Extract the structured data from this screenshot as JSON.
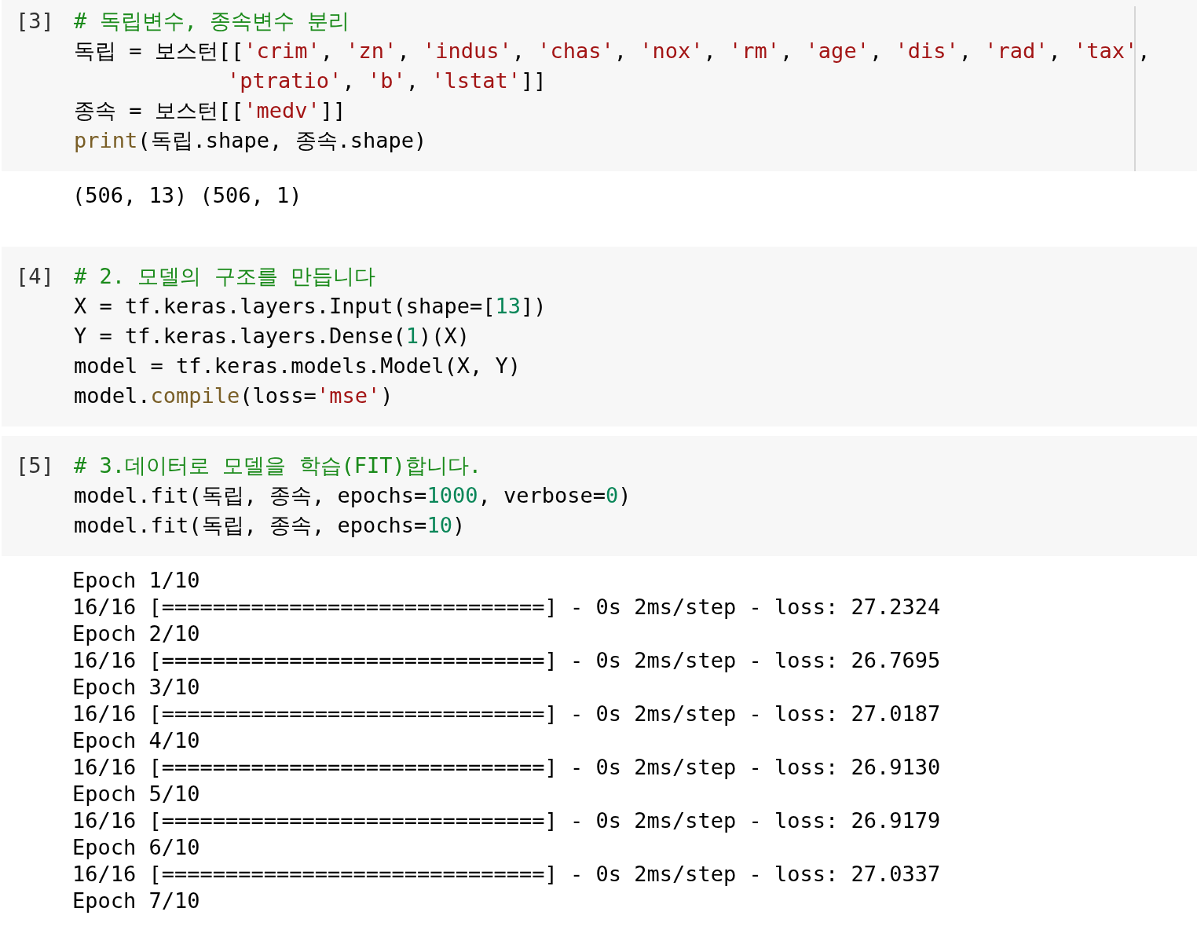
{
  "cells": [
    {
      "prompt": "[3]",
      "ruler": true,
      "code": [
        [
          {
            "kind": "comment",
            "text": "# 독립변수, 종속변수 분리"
          }
        ],
        [
          {
            "kind": "plain",
            "text": "독립 = 보스턴[["
          },
          {
            "kind": "string",
            "text": "'crim'"
          },
          {
            "kind": "plain",
            "text": ", "
          },
          {
            "kind": "string",
            "text": "'zn'"
          },
          {
            "kind": "plain",
            "text": ", "
          },
          {
            "kind": "string",
            "text": "'indus'"
          },
          {
            "kind": "plain",
            "text": ", "
          },
          {
            "kind": "string",
            "text": "'chas'"
          },
          {
            "kind": "plain",
            "text": ", "
          },
          {
            "kind": "string",
            "text": "'nox'"
          },
          {
            "kind": "plain",
            "text": ", "
          },
          {
            "kind": "string",
            "text": "'rm'"
          },
          {
            "kind": "plain",
            "text": ", "
          },
          {
            "kind": "string",
            "text": "'age'"
          },
          {
            "kind": "plain",
            "text": ", "
          },
          {
            "kind": "string",
            "text": "'dis'"
          },
          {
            "kind": "plain",
            "text": ", "
          },
          {
            "kind": "string",
            "text": "'rad'"
          },
          {
            "kind": "plain",
            "text": ", "
          },
          {
            "kind": "string",
            "text": "'tax'"
          },
          {
            "kind": "plain",
            "text": ","
          }
        ],
        [
          {
            "kind": "string",
            "text": "'ptratio'"
          },
          {
            "kind": "plain",
            "text": ", "
          },
          {
            "kind": "string",
            "text": "'b'"
          },
          {
            "kind": "plain",
            "text": ", "
          },
          {
            "kind": "string",
            "text": "'lstat'"
          },
          {
            "kind": "plain",
            "text": "]]"
          }
        ],
        [
          {
            "kind": "plain",
            "text": "종속 = 보스턴[["
          },
          {
            "kind": "string",
            "text": "'medv'"
          },
          {
            "kind": "plain",
            "text": "]]"
          }
        ],
        [
          {
            "kind": "builtin",
            "text": "print"
          },
          {
            "kind": "plain",
            "text": "(독립.shape, 종속.shape)"
          }
        ]
      ],
      "output": [
        "(506, 13) (506, 1)"
      ]
    },
    {
      "prompt": "[4]",
      "ruler": false,
      "code": [
        [
          {
            "kind": "comment",
            "text": "# 2. 모델의 구조를 만듭니다"
          }
        ],
        [
          {
            "kind": "plain",
            "text": "X = tf.keras.layers.Input(shape=["
          },
          {
            "kind": "number",
            "text": "13"
          },
          {
            "kind": "plain",
            "text": "])"
          }
        ],
        [
          {
            "kind": "plain",
            "text": "Y = tf.keras.layers.Dense("
          },
          {
            "kind": "number",
            "text": "1"
          },
          {
            "kind": "plain",
            "text": ")(X)"
          }
        ],
        [
          {
            "kind": "plain",
            "text": "model = tf.keras.models.Model(X, Y)"
          }
        ],
        [
          {
            "kind": "plain",
            "text": "model."
          },
          {
            "kind": "builtin",
            "text": "compile"
          },
          {
            "kind": "plain",
            "text": "(loss="
          },
          {
            "kind": "string",
            "text": "'mse'"
          },
          {
            "kind": "plain",
            "text": ")"
          }
        ]
      ]
    },
    {
      "prompt": "[5]",
      "ruler": false,
      "code": [
        [
          {
            "kind": "comment",
            "text": "# 3.데이터로 모델을 학습(FIT)합니다."
          }
        ],
        [
          {
            "kind": "plain",
            "text": "model.fit(독립, 종속, epochs="
          },
          {
            "kind": "number",
            "text": "1000"
          },
          {
            "kind": "plain",
            "text": ", verbose="
          },
          {
            "kind": "number",
            "text": "0"
          },
          {
            "kind": "plain",
            "text": ")"
          }
        ],
        [
          {
            "kind": "plain",
            "text": "model.fit(독립, 종속, epochs="
          },
          {
            "kind": "number",
            "text": "10"
          },
          {
            "kind": "plain",
            "text": ")"
          }
        ]
      ],
      "output": [
        "Epoch 1/10",
        "16/16 [==============================] - 0s 2ms/step - loss: 27.2324",
        "Epoch 2/10",
        "16/16 [==============================] - 0s 2ms/step - loss: 26.7695",
        "Epoch 3/10",
        "16/16 [==============================] - 0s 2ms/step - loss: 27.0187",
        "Epoch 4/10",
        "16/16 [==============================] - 0s 2ms/step - loss: 26.9130",
        "Epoch 5/10",
        "16/16 [==============================] - 0s 2ms/step - loss: 26.9179",
        "Epoch 6/10",
        "16/16 [==============================] - 0s 2ms/step - loss: 27.0337",
        "Epoch 7/10"
      ]
    }
  ]
}
